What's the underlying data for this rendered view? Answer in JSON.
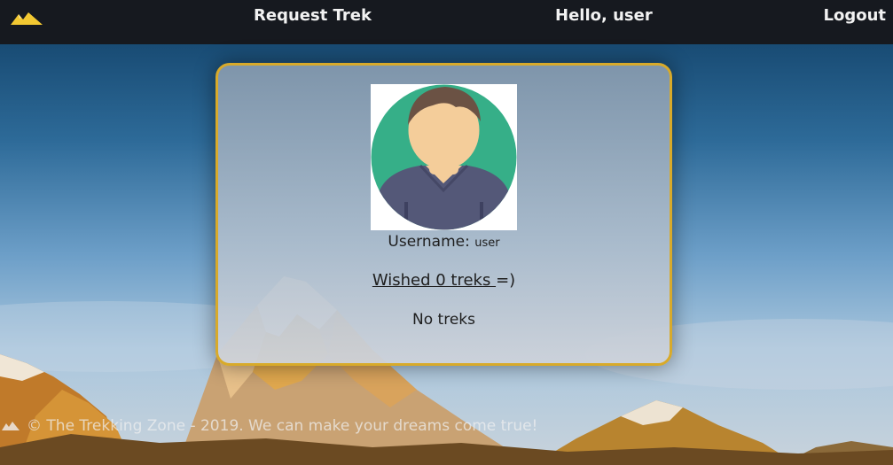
{
  "nav": {
    "request_trek": "Request Trek",
    "greeting": "Hello, user",
    "logout": "Logout"
  },
  "profile": {
    "username_label": "Username:",
    "username_value": "user",
    "wished_link": "Wished 0 treks ",
    "wished_suffix": "=)",
    "empty_message": "No treks"
  },
  "footer": {
    "text": "© The Trekking Zone - 2019. We can make your dreams come true!"
  },
  "colors": {
    "nav_bg": "#16191f",
    "card_border": "#d8aa2a",
    "logo_yellow": "#f2c832",
    "avatar_green": "#36af88",
    "avatar_skin": "#f4cd9a",
    "avatar_hair": "#6b5244",
    "avatar_shirt": "#545878"
  },
  "icons": {
    "logo": "mountain-logo-icon",
    "avatar": "user-avatar-icon"
  }
}
